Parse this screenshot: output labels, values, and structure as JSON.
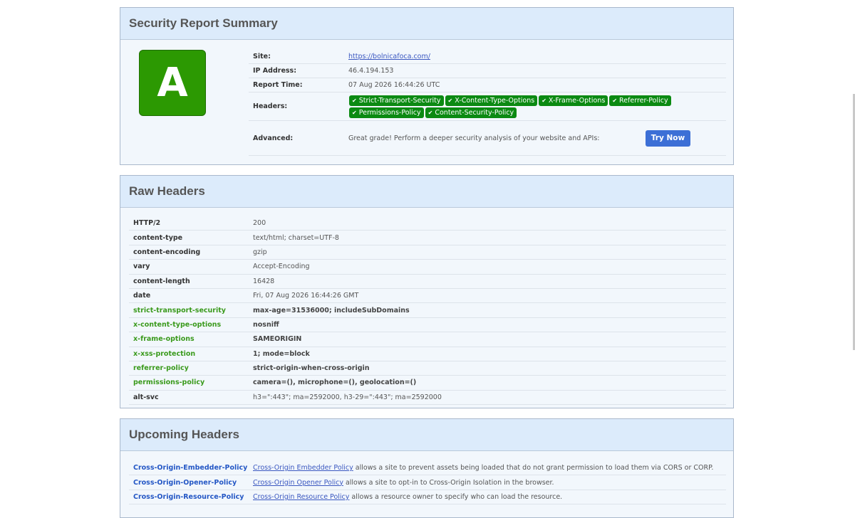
{
  "summary": {
    "title": "Security Report Summary",
    "grade": "A",
    "grade_color": "#2c9902",
    "labels": {
      "site": "Site:",
      "ip": "IP Address:",
      "report_time": "Report Time:",
      "headers": "Headers:",
      "advanced": "Advanced:"
    },
    "site": "https://bolnicafoca.com/",
    "ip": "46.4.194.153",
    "report_time": "07 Aug 2026 16:44:26 UTC",
    "header_pills": [
      "Strict-Transport-Security",
      "X-Content-Type-Options",
      "X-Frame-Options",
      "Referrer-Policy",
      "Permissions-Policy",
      "Content-Security-Policy"
    ],
    "pill_icon": "check-icon",
    "pill_color": "#0b8a12",
    "advanced_text": "Great grade! Perform a deeper security analysis of your website and APIs:",
    "try_button": "Try Now"
  },
  "raw": {
    "title": "Raw Headers",
    "rows": [
      {
        "key": "HTTP/2",
        "value": "200"
      },
      {
        "key": "content-type",
        "value": "text/html; charset=UTF-8"
      },
      {
        "key": "content-encoding",
        "value": "gzip"
      },
      {
        "key": "vary",
        "value": "Accept-Encoding"
      },
      {
        "key": "content-length",
        "value": "16428"
      },
      {
        "key": "date",
        "value": "Fri, 07 Aug 2026 16:44:26 GMT"
      },
      {
        "key": "strict-transport-security",
        "value": "max-age=31536000; includeSubDomains"
      },
      {
        "key": "x-content-type-options",
        "value": "nosniff"
      },
      {
        "key": "x-frame-options",
        "value": "SAMEORIGIN"
      },
      {
        "key": "x-xss-protection",
        "value": "1; mode=block"
      },
      {
        "key": "referrer-policy",
        "value": "strict-origin-when-cross-origin"
      },
      {
        "key": "permissions-policy",
        "value": "camera=(), microphone=(), geolocation=()"
      },
      {
        "key": "alt-svc",
        "value": "h3=\":443\"; ma=2592000, h3-29=\":443\"; ma=2592000"
      }
    ]
  },
  "upcoming": {
    "title": "Upcoming Headers",
    "rows": [
      {
        "key": "Cross-Origin-Embedder-Policy",
        "link": "Cross-Origin Embedder Policy",
        "text": " allows a site to prevent assets being loaded that do not grant permission to load them via CORS or CORP."
      },
      {
        "key": "Cross-Origin-Opener-Policy",
        "link": "Cross-Origin Opener Policy",
        "text": " allows a site to opt-in to Cross-Origin Isolation in the browser."
      },
      {
        "key": "Cross-Origin-Resource-Policy",
        "link": "Cross-Origin Resource Policy",
        "text": " allows a resource owner to specify who can load the resource."
      }
    ]
  }
}
